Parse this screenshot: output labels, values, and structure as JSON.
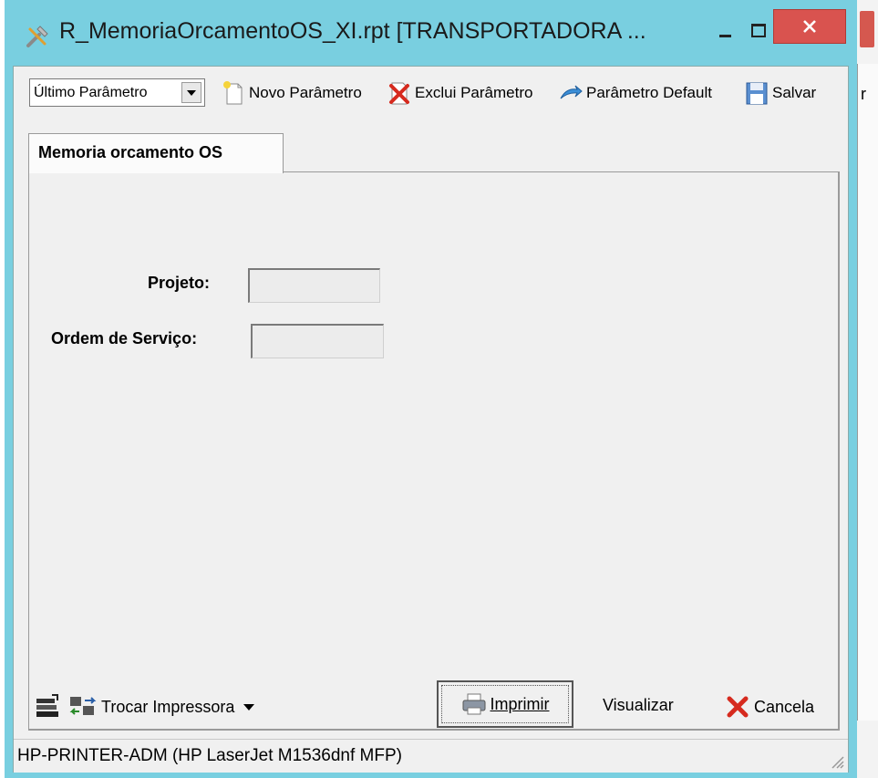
{
  "window": {
    "title": "R_MemoriaOrcamentoOS_XI.rpt [TRANSPORTADORA ..."
  },
  "toolbar": {
    "param_combo_value": "Último Parâmetro",
    "new_param_label": "Novo Parâmetro",
    "delete_param_label": "Exclui Parâmetro",
    "default_param_label": "Parâmetro Default",
    "save_label": "Salvar"
  },
  "tabs": [
    {
      "label": "Memoria orcamento OS",
      "active": true
    }
  ],
  "form": {
    "projeto_label": "Projeto:",
    "projeto_value": "",
    "ordem_label": "Ordem de Serviço:",
    "ordem_value": ""
  },
  "footer": {
    "change_printer_label": "Trocar Impressora",
    "print_label": "Imprimir",
    "preview_label": "Visualizar",
    "cancel_label": "Cancela"
  },
  "status": {
    "printer": "HP-PRINTER-ADM (HP LaserJet M1536dnf MFP)"
  },
  "background": {
    "partial_text": "r"
  },
  "colors": {
    "window_frame": "#79cfe0",
    "close_button": "#d9534f",
    "client_bg": "#f0f0f0"
  },
  "icons": {
    "app": "tools-icon",
    "new_param": "new-document-icon",
    "delete_param": "delete-document-icon",
    "default_param": "blue-arrow-icon",
    "save": "floppy-disk-icon",
    "printer_setup": "printer-setup-icon",
    "swap_printer": "swap-printer-icon",
    "print": "printer-icon",
    "cancel": "red-x-icon"
  }
}
